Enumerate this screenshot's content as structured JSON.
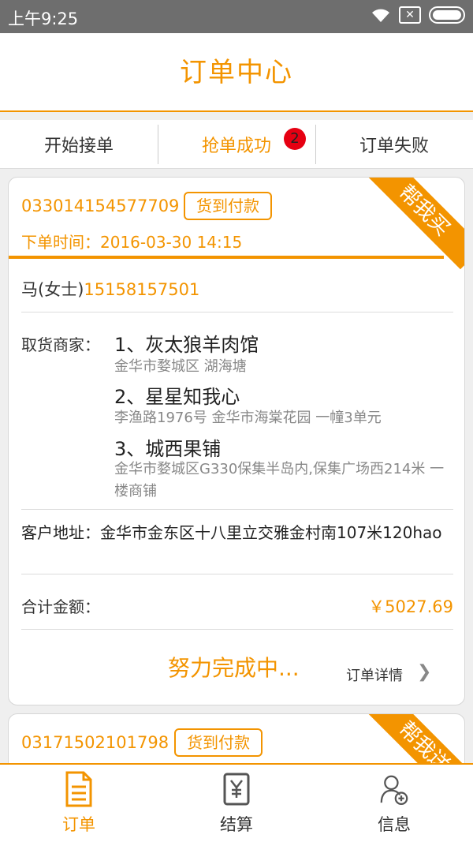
{
  "status_bar": {
    "time": "上午9:25",
    "wifi_icon": "wifi-icon",
    "sim_icon": "sim-off-icon",
    "battery_icon": "battery-icon"
  },
  "header": {
    "title": "订单中心"
  },
  "tabs": [
    {
      "label": "开始接单",
      "active": false
    },
    {
      "label": "抢单成功",
      "active": true,
      "badge": "2"
    },
    {
      "label": "订单失败",
      "active": false
    }
  ],
  "orders": [
    {
      "order_no": "033014154577709",
      "payment": "货到付款",
      "ribbon": "帮我买",
      "order_time": "下单时间：2016-03-30 14:15",
      "customer_name": "马(女士)",
      "customer_phone": "15158157501",
      "shops_label": "取货商家：",
      "shops": [
        {
          "name": "1、灰太狼羊肉馆",
          "address": "金华市婺城区 湖海塘"
        },
        {
          "name": "2、星星知我心",
          "address": "李渔路1976号 金华市海棠花园 一幢3单元"
        },
        {
          "name": "3、城西果铺",
          "address": "金华市婺城区G330保集半岛内,保集广场西214米  一楼商铺"
        }
      ],
      "address_label": "客户地址：",
      "address": "金华市金东区十八里立交雅金村南107米120hao",
      "amount_label": "合计金额：",
      "amount": "￥5027.69",
      "progress": "努力完成中...",
      "detail_link": "订单详情"
    },
    {
      "order_no": "03171502101798",
      "payment": "货到付款",
      "ribbon": "帮我送"
    }
  ],
  "bottom_nav": [
    {
      "label": "订单",
      "icon": "order-document-icon",
      "active": true
    },
    {
      "label": "结算",
      "icon": "yuan-settlement-icon",
      "active": false
    },
    {
      "label": "信息",
      "icon": "user-info-icon",
      "active": false
    }
  ],
  "colors": {
    "accent": "#f39400",
    "badge": "#e60012"
  }
}
